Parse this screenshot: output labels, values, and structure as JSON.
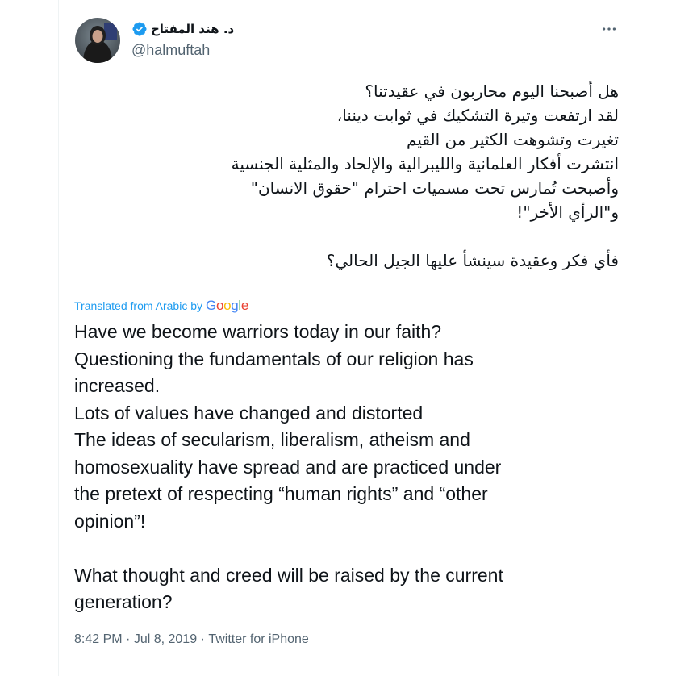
{
  "tweet": {
    "display_name": "د. هند المفتاح",
    "handle": "@halmuftah",
    "more_icon": "ellipsis-icon",
    "verified_icon": "verified-badge-icon",
    "colors": {
      "accent": "#1d9bf0",
      "text": "#0f1419",
      "secondary": "#536471"
    },
    "arabic_lines": [
      "هل أصبحنا اليوم محاربون في عقيدتنا؟",
      "لقد ارتفعت وتيرة التشكيك في ثوابت ديننا،",
      "تغيرت وتشوهت الكثير من القيم",
      "انتشرت أفكار العلمانية والليبرالية والإلحاد والمثلية الجنسية",
      "وأصبحت تُمارس تحت مسميات احترام \"حقوق الانسان\"",
      "و\"الرأي الأخر\"!",
      "فأي فكر وعقيدة سينشأ عليها الجيل الحالي؟"
    ],
    "translation": {
      "label": "Translated from Arabic by",
      "provider": "Google"
    },
    "english_lines": [
      "Have we become warriors today in our faith?",
      "Questioning the fundamentals of our religion has",
      "increased.",
      "Lots of values have changed and distorted",
      "The ideas of secularism, liberalism, atheism and",
      "homosexuality have spread and are practiced under",
      "the pretext of respecting “human rights” and “other",
      "opinion”!",
      "What thought and creed will be raised by the current",
      "generation?"
    ],
    "meta": {
      "time": "8:42 PM",
      "separator": " · ",
      "date": "Jul 8, 2019",
      "source": "Twitter for iPhone"
    }
  }
}
